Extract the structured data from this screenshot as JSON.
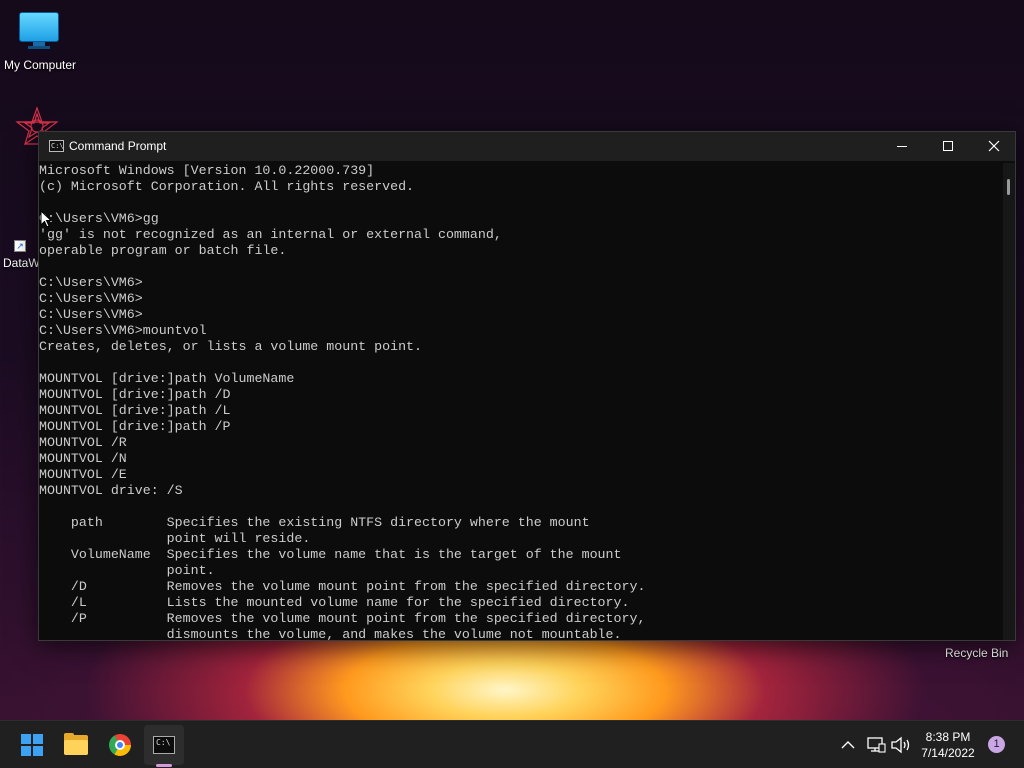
{
  "desktop": {
    "icons": [
      {
        "label": "My Computer"
      },
      {
        "label": "DataW"
      },
      {
        "label": "Recycle Bin"
      }
    ]
  },
  "window": {
    "title": "Command Prompt",
    "controls": {
      "minimize": "minimize",
      "maximize": "maximize",
      "close": "close"
    },
    "console_lines": [
      "Microsoft Windows [Version 10.0.22000.739]",
      "(c) Microsoft Corporation. All rights reserved.",
      "",
      "C:\\Users\\VM6>gg",
      "'gg' is not recognized as an internal or external command,",
      "operable program or batch file.",
      "",
      "C:\\Users\\VM6>",
      "C:\\Users\\VM6>",
      "C:\\Users\\VM6>",
      "C:\\Users\\VM6>mountvol",
      "Creates, deletes, or lists a volume mount point.",
      "",
      "MOUNTVOL [drive:]path VolumeName",
      "MOUNTVOL [drive:]path /D",
      "MOUNTVOL [drive:]path /L",
      "MOUNTVOL [drive:]path /P",
      "MOUNTVOL /R",
      "MOUNTVOL /N",
      "MOUNTVOL /E",
      "MOUNTVOL drive: /S",
      "",
      "    path        Specifies the existing NTFS directory where the mount",
      "                point will reside.",
      "    VolumeName  Specifies the volume name that is the target of the mount",
      "                point.",
      "    /D          Removes the volume mount point from the specified directory.",
      "    /L          Lists the mounted volume name for the specified directory.",
      "    /P          Removes the volume mount point from the specified directory,",
      "                dismounts the volume, and makes the volume not mountable."
    ]
  },
  "taskbar": {
    "apps": [
      "start",
      "file-explorer",
      "chrome",
      "command-prompt"
    ],
    "clock": {
      "time": "8:38 PM",
      "date": "7/14/2022"
    },
    "notification_count": "1",
    "tray_overflow": "^"
  },
  "colors": {
    "console_bg": "#0c0c0c",
    "console_text": "#cccccc",
    "titlebar": "#1f1f1f",
    "taskbar": "#202020",
    "windows_blue": "#3ea2f3",
    "active_indicator": "#d79ad9"
  }
}
